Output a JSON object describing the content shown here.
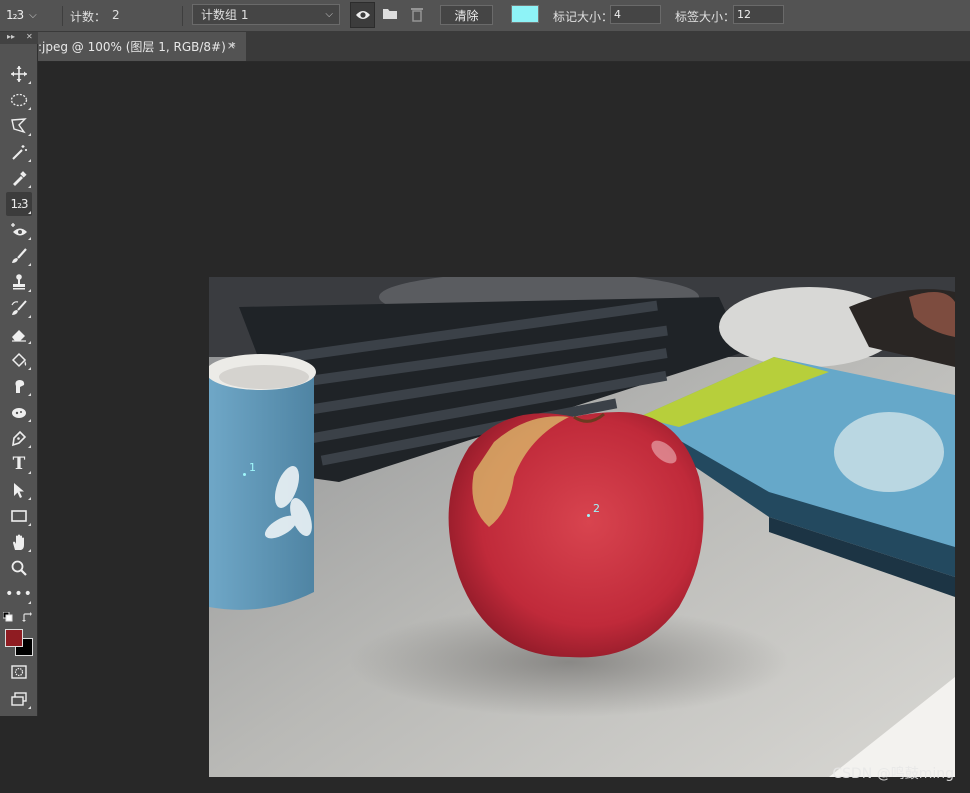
{
  "options_bar": {
    "tool_preset_glyph": "1₂3",
    "count_label": "计数：",
    "count_value": "2",
    "count_group": "计数组 1",
    "clear_label": "清除",
    "marker_color": "#8ef3f7",
    "marker_size_label": "标记大小：",
    "marker_size_value": "4",
    "label_size_label": "标签大小：",
    "label_size_value": "12"
  },
  "document_tab": {
    "title": ":jpeg @ 100% (图层 1, RGB/8#) *",
    "close_glyph": "×"
  },
  "toolbox": {
    "collapse_glyph": "▸▸",
    "close_glyph": "✕",
    "count_tool_glyph": "1₂3",
    "text_tool_glyph": "T",
    "more_tools_glyph": "•••",
    "foreground_color": "#8f1c22",
    "background_color": "#000000"
  },
  "canvas": {
    "count_markers": [
      {
        "label": "1"
      },
      {
        "label": "2"
      }
    ]
  },
  "watermark": "CSDN @鸣鼓ming"
}
